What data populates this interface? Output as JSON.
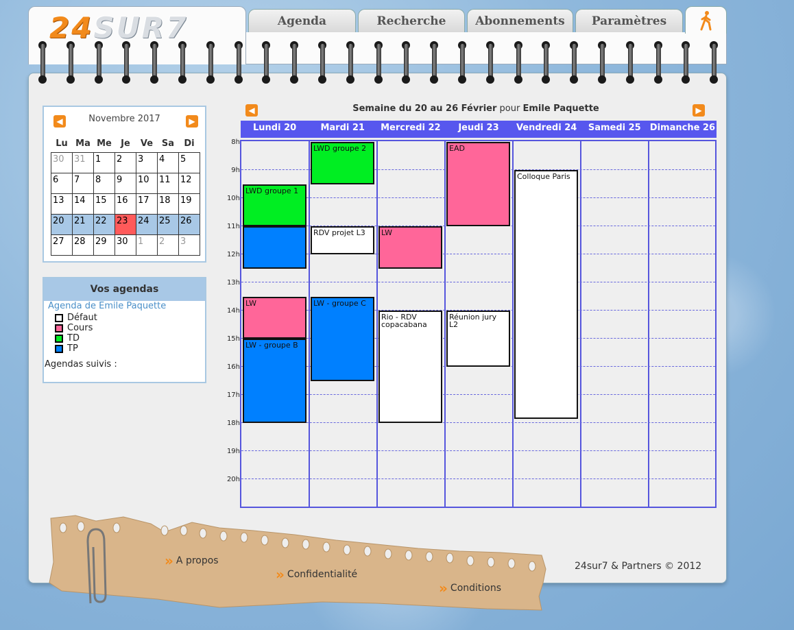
{
  "app": {
    "logo_numbers": "24",
    "logo_text": "SUR7"
  },
  "tabs": [
    {
      "label": "Agenda"
    },
    {
      "label": "Recherche"
    },
    {
      "label": "Abonnements"
    },
    {
      "label": "Paramètres"
    }
  ],
  "exit_icon": "walking-person-icon",
  "minical": {
    "month": "Novembre 2017",
    "prev_icon": "arrow-left-icon",
    "next_icon": "arrow-right-icon",
    "weekdays": [
      "Lu",
      "Ma",
      "Me",
      "Je",
      "Ve",
      "Sa",
      "Di"
    ],
    "weeks": [
      [
        "30",
        "31",
        "1",
        "2",
        "3",
        "4",
        "5"
      ],
      [
        "6",
        "7",
        "8",
        "9",
        "10",
        "11",
        "12"
      ],
      [
        "13",
        "14",
        "15",
        "16",
        "17",
        "18",
        "19"
      ],
      [
        "20",
        "21",
        "22",
        "23",
        "24",
        "25",
        "26"
      ],
      [
        "27",
        "28",
        "29",
        "30",
        "1",
        "2",
        "3"
      ]
    ],
    "today": "23"
  },
  "agendas": {
    "title": "Vos agendas",
    "owner": "Agenda de Emile Paquette",
    "categories": [
      {
        "label": "Défaut",
        "color": "#ffffff"
      },
      {
        "label": "Cours",
        "color": "#ff6699"
      },
      {
        "label": "TD",
        "color": "#00ee22"
      },
      {
        "label": "TP",
        "color": "#0080ff"
      }
    ],
    "followed_label": "Agendas suivis :"
  },
  "week": {
    "title_prefix": "Semaine du 20 au 26 Février",
    "title_for": "pour",
    "user": "Emile Paquette",
    "days": [
      "Lundi 20",
      "Mardi 21",
      "Mercredi 22",
      "Jeudi 23",
      "Vendredi 24",
      "Samedi 25",
      "Dimanche 26"
    ],
    "hours": [
      "8h",
      "9h",
      "10h",
      "11h",
      "12h",
      "13h",
      "14h",
      "15h",
      "16h",
      "17h",
      "18h",
      "19h",
      "20h"
    ]
  },
  "events": [
    {
      "day": 0,
      "start": 9.5,
      "end": 11.0,
      "title": "LWD groupe 1",
      "type": "td"
    },
    {
      "day": 0,
      "start": 11.0,
      "end": 12.5,
      "title": "",
      "type": "tp"
    },
    {
      "day": 0,
      "start": 13.5,
      "end": 15.0,
      "title": "LW",
      "type": "cours"
    },
    {
      "day": 0,
      "start": 15.0,
      "end": 18.0,
      "title": "LW - groupe B",
      "type": "tp"
    },
    {
      "day": 1,
      "start": 8.0,
      "end": 9.5,
      "title": "LWD groupe 2",
      "type": "td"
    },
    {
      "day": 1,
      "start": 11.0,
      "end": 12.0,
      "title": "RDV projet L3",
      "type": "def"
    },
    {
      "day": 1,
      "start": 13.5,
      "end": 16.5,
      "title": "LW - groupe C",
      "type": "tp"
    },
    {
      "day": 2,
      "start": 11.0,
      "end": 12.5,
      "title": "LW",
      "type": "cours"
    },
    {
      "day": 2,
      "start": 14.0,
      "end": 18.0,
      "title": "Rio - RDV copacabana",
      "type": "def"
    },
    {
      "day": 3,
      "start": 8.0,
      "end": 11.0,
      "title": "EAD",
      "type": "cours"
    },
    {
      "day": 3,
      "start": 14.0,
      "end": 16.0,
      "title": "Réunion jury L2",
      "type": "def"
    },
    {
      "day": 4,
      "start": 9.0,
      "end": 17.85,
      "title": "Colloque Paris",
      "type": "def"
    }
  ],
  "footer": {
    "about": "A propos",
    "privacy": "Confidentialité",
    "conditions": "Conditions",
    "copyright": "24sur7 & Partners © 2012"
  }
}
